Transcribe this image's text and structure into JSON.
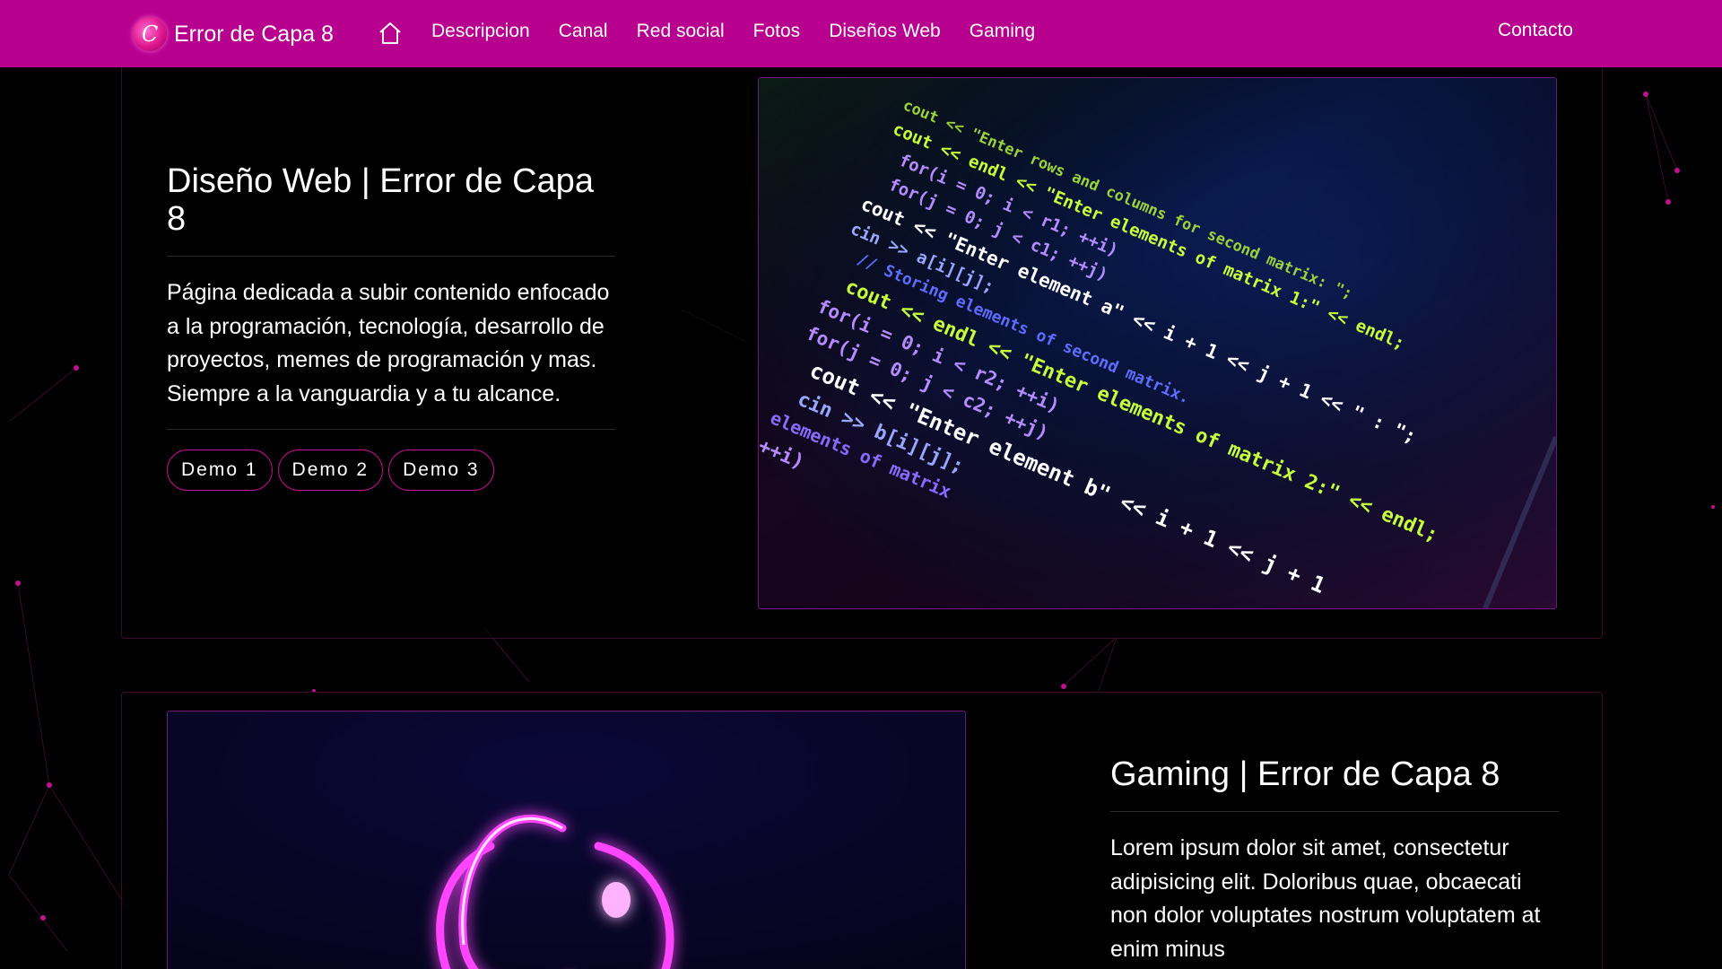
{
  "navbar": {
    "brand_logo_glyph": "C",
    "brand": "Error de Capa 8",
    "links": [
      {
        "label": "Descripcion"
      },
      {
        "label": "Canal"
      },
      {
        "label": "Red social"
      },
      {
        "label": "Fotos"
      },
      {
        "label": "Diseños Web"
      },
      {
        "label": "Gaming"
      }
    ],
    "contact": "Contacto",
    "bg_color": "#b8008f"
  },
  "sections": [
    {
      "title": "Diseño Web | Error de Capa 8",
      "description": "Página dedicada a subir contenido enfocado a la programación, tecnología, desarrollo de proyectos, memes de programación y mas. Siempre a la vanguardia y a tu alcance.",
      "buttons": [
        "Demo 1",
        "Demo 2",
        "Demo 3"
      ],
      "image_icon": "code-screen-image"
    },
    {
      "title": "Gaming | Error de Capa 8",
      "description": "Lorem ipsum dolor sit amet, consectetur adipisicing elit. Doloribus quae, obcaecati non dolor voluptates nostrum voluptatem at enim minus",
      "image_icon": "neon-logo-image"
    }
  ],
  "colors": {
    "accent": "#c2118f",
    "background": "#000000"
  },
  "code_lines": [
    {
      "t": "cout << \"Enter rows and columns for second matrix: \";",
      "c": "#9cd23a"
    },
    {
      "t": "cout << endl << \"Enter elements of matrix 1:\" << endl;",
      "c": "#c6ff3a"
    },
    {
      "t": "for(i = 0; i < r1; ++i)",
      "c": "#b58cff"
    },
    {
      "t": "for(j = 0; j < c1; ++j)",
      "c": "#b58cff"
    },
    {
      "t": "cout << \"Enter element a\" << i + 1 << j + 1 << \" : \";",
      "c": "#ffffff"
    },
    {
      "t": "cin >> a[i][j];",
      "c": "#9aa7ff"
    },
    {
      "t": "// Storing elements of second matrix.",
      "c": "#5f6cff"
    },
    {
      "t": "cout << endl << \"Enter elements of matrix 2:\" << endl;",
      "c": "#c6ff3a"
    },
    {
      "t": "for(i = 0; i < r2; ++i)",
      "c": "#b58cff"
    },
    {
      "t": "for(j = 0; j < c2; ++j)",
      "c": "#b58cff"
    },
    {
      "t": "cout << \"Enter element b\" << i + 1 << j + 1",
      "c": "#ffffff"
    },
    {
      "t": "cin >> b[i][j];",
      "c": "#9aa7ff"
    },
    {
      "t": "elements of matrix",
      "c": "#8a6bff"
    },
    {
      "t": "++i)",
      "c": "#b58cff"
    }
  ]
}
